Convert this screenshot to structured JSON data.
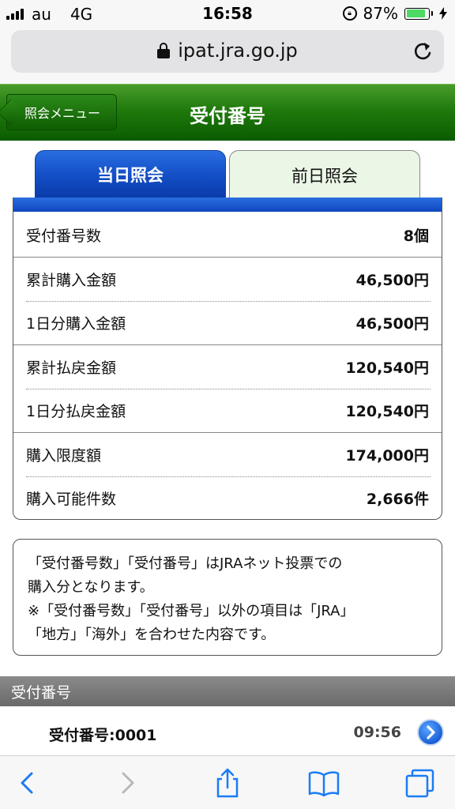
{
  "status_bar": {
    "carrier": "au",
    "network": "4G",
    "time": "16:58",
    "battery_percent_text": "87%",
    "battery_level": 0.87
  },
  "browser": {
    "url": "ipat.jra.go.jp"
  },
  "header": {
    "back_label": "照会メニュー",
    "title": "受付番号"
  },
  "tabs": [
    {
      "label": "当日照会",
      "active": true
    },
    {
      "label": "前日照会",
      "active": false
    }
  ],
  "summary": {
    "rows": [
      {
        "label": "受付番号数",
        "value": "8個"
      },
      {
        "label": "累計購入金額",
        "value": "46,500円"
      },
      {
        "label": "1日分購入金額",
        "value": "46,500円"
      },
      {
        "label": "累計払戻金額",
        "value": "120,540円"
      },
      {
        "label": "1日分払戻金額",
        "value": "120,540円"
      },
      {
        "label": "購入限度額",
        "value": "174,000円"
      },
      {
        "label": "購入可能件数",
        "value": "2,666件"
      }
    ]
  },
  "note": {
    "lines": [
      "「受付番号数」「受付番号」はJRAネット投票での",
      "購入分となります。",
      "※「受付番号数」「受付番号」以外の項目は「JRA」",
      "「地方」「海外」を合わせた内容です。"
    ]
  },
  "section": {
    "title": "受付番号"
  },
  "list": [
    {
      "label": "受付番号:0001",
      "time": "09:56"
    }
  ],
  "colors": {
    "header_green": "#1f7a0c",
    "tab_blue": "#1450c8",
    "tab_inactive_bg": "#eaf6e6",
    "ios_blue": "#1a7cf5"
  }
}
